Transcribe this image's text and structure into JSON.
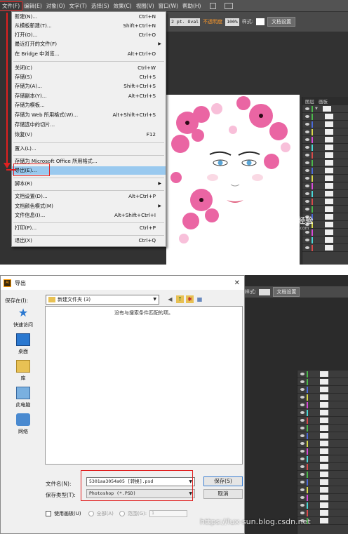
{
  "screen1": {
    "menubar": {
      "items": [
        "文件(F)",
        "编辑(E)",
        "对象(O)",
        "文字(T)",
        "选择(S)",
        "效果(C)",
        "视图(V)",
        "窗口(W)",
        "帮助(H)"
      ]
    },
    "options_bar": {
      "stroke": "2 pt. Oval",
      "opacity_label": "不透明度",
      "opacity_value": "100%",
      "style_label": "样式:",
      "doc_setup": "文档设置"
    },
    "file_menu": [
      {
        "label": "新建(N)...",
        "shortcut": "Ctrl+N"
      },
      {
        "label": "从模板新建(T)...",
        "shortcut": "Shift+Ctrl+N"
      },
      {
        "label": "打开(O)...",
        "shortcut": "Ctrl+O"
      },
      {
        "label": "最近打开的文件(F)",
        "shortcut": ""
      },
      {
        "label": "在 Bridge 中浏览...",
        "shortcut": "Alt+Ctrl+O"
      },
      {
        "label": "关闭(C)",
        "shortcut": "Ctrl+W"
      },
      {
        "label": "存储(S)",
        "shortcut": "Ctrl+S"
      },
      {
        "label": "存储为(A)...",
        "shortcut": "Shift+Ctrl+S"
      },
      {
        "label": "存储副本(Y)...",
        "shortcut": "Alt+Ctrl+S"
      },
      {
        "label": "存储为模板...",
        "shortcut": ""
      },
      {
        "label": "存储为 Web 所用格式(W)...",
        "shortcut": "Alt+Shift+Ctrl+S"
      },
      {
        "label": "存储选中的切片...",
        "shortcut": ""
      },
      {
        "label": "恢复(V)",
        "shortcut": "F12"
      },
      {
        "label": "置入(L)...",
        "shortcut": ""
      },
      {
        "label": "存储为 Microsoft Office 所用格式...",
        "shortcut": ""
      },
      {
        "label": "导出(E)...",
        "shortcut": ""
      },
      {
        "label": "脚本(R)",
        "shortcut": ""
      },
      {
        "label": "文档设置(D)...",
        "shortcut": "Alt+Ctrl+P"
      },
      {
        "label": "文档颜色模式(M)",
        "shortcut": ""
      },
      {
        "label": "文件信息(I)...",
        "shortcut": "Alt+Shift+Ctrl+I"
      },
      {
        "label": "打印(P)...",
        "shortcut": "Ctrl+P"
      },
      {
        "label": "退出(X)",
        "shortcut": "Ctrl+Q"
      }
    ],
    "layers_tabs": [
      "图层",
      "画板"
    ],
    "watermark": "Baidu 经验",
    "watermark_url": "jingyan.baidu.com"
  },
  "screen2": {
    "topbar": {
      "style_label": "样式:",
      "doc_setup": "文档设置"
    },
    "dialog": {
      "title": "导出",
      "close": "✕",
      "save_in_label": "保存在(I):",
      "folder": "新建文件夹 (3)",
      "empty_message": "没有与搜索条件匹配的项。",
      "places": [
        "快速访问",
        "桌面",
        "库",
        "此电脑",
        "网络"
      ],
      "filename_label": "文件名(N):",
      "filename_value": "5301aa3054a05 [转换].psd",
      "filetype_label": "保存类型(T):",
      "filetype_value": "Photoshop (*.PSD)",
      "save_button": "保存(S)",
      "cancel_button": "取消",
      "use_artboards": "使用画板(U)",
      "all_label": "全部(A)",
      "range_label": "范围(G):",
      "range_value": "1"
    },
    "blog_watermark": "https://lux-sun.blog.csdn.net"
  },
  "colors": {
    "highlight": "#99c9ef",
    "annotation_red": "#e02020",
    "flower_pink": "#e8559a"
  }
}
